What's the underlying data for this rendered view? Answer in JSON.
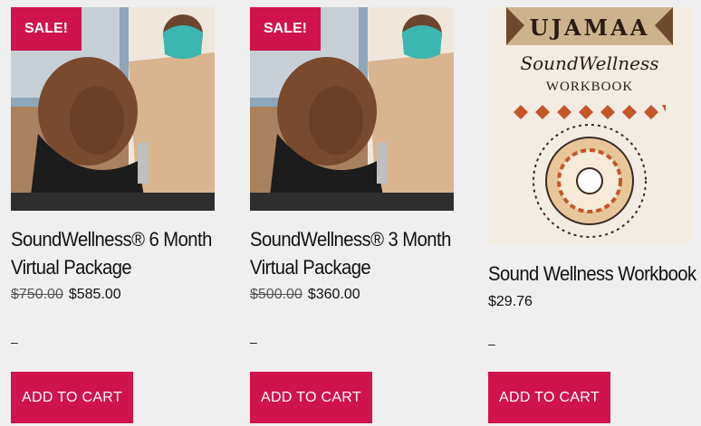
{
  "products": [
    {
      "sale_badge": "SALE!",
      "title_line1": "SoundWellness® 6 Month",
      "title_line2": "Virtual Package",
      "old_price": "$750.00",
      "price": "$585.00",
      "dash": "–",
      "button": "ADD TO CART"
    },
    {
      "sale_badge": "SALE!",
      "title_line1": "SoundWellness® 3 Month",
      "title_line2": "Virtual Package",
      "old_price": "$500.00",
      "price": "$360.00",
      "dash": "–",
      "button": "ADD TO CART"
    },
    {
      "title_line1": "Sound Wellness Workbook",
      "price": "$29.76",
      "dash": "–",
      "button": "ADD TO CART",
      "book_header": "UJAMAA",
      "book_title": "SoundWellness",
      "book_subtitle": "WORKBOOK"
    }
  ],
  "colors": {
    "accent": "#d0134d",
    "background": "#efefef"
  }
}
